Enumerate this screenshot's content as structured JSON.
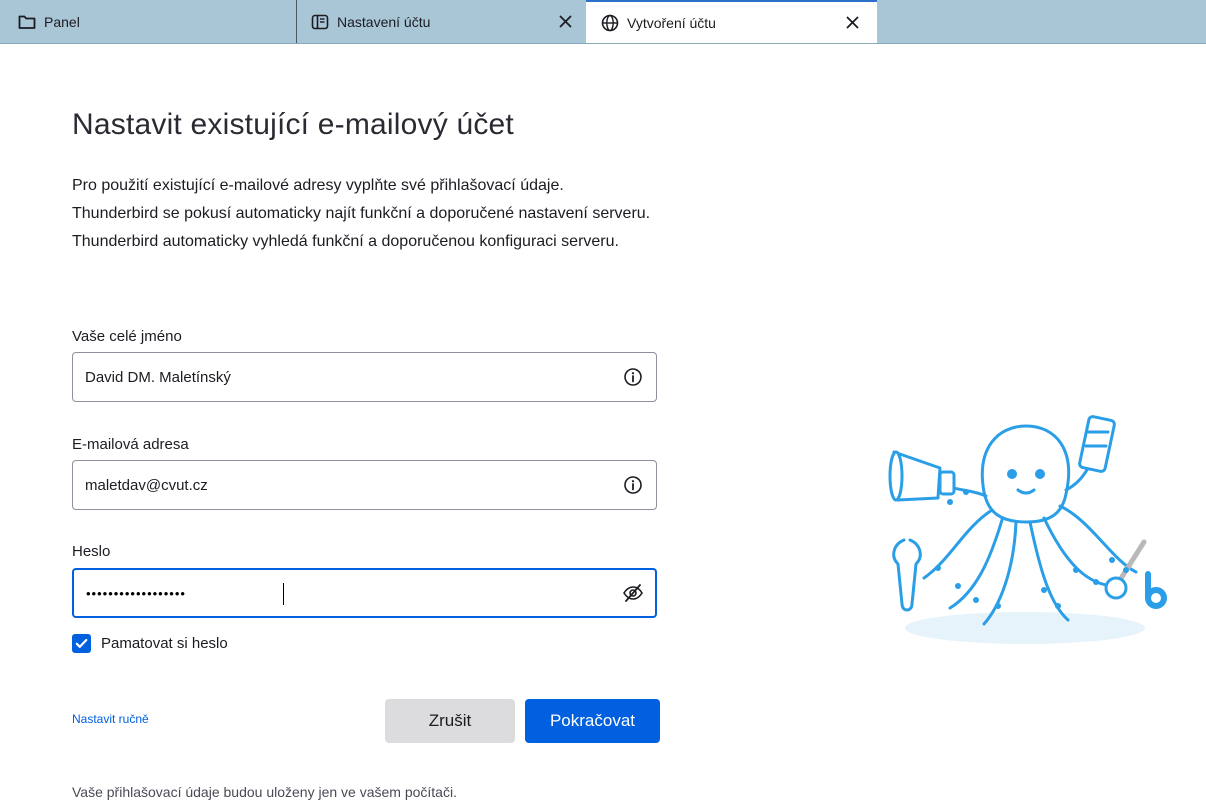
{
  "tabs": [
    {
      "label": "Panel",
      "icon": "folder-icon"
    },
    {
      "label": "Nastavení účtu",
      "icon": "account-settings-icon"
    },
    {
      "label": "Vytvoření účtu",
      "icon": "globe-icon"
    }
  ],
  "page": {
    "title": "Nastavit existující e-mailový účet",
    "description_lines": [
      "Pro použití existující e-mailové adresy vyplňte své přihlašovací údaje.",
      "Thunderbird se pokusí automaticky najít funkční a doporučené nastavení serveru.",
      "Thunderbird automaticky vyhledá funkční a doporučenou konfiguraci serveru."
    ]
  },
  "form": {
    "name_label": "Vaše celé jméno",
    "name_value": "David DM. Maletínský",
    "email_label": "E-mailová adresa",
    "email_value": "maletdav@cvut.cz",
    "password_label": "Heslo",
    "password_masked": "••••••••••••••••••",
    "remember_label": "Pamatovat si heslo",
    "remember_checked": true
  },
  "actions": {
    "manual_label": "Nastavit ručně",
    "cancel_label": "Zrušit",
    "continue_label": "Pokračovat"
  },
  "footer_note": "Vaše přihlašovací údaje budou uloženy jen ve vašem počítači.",
  "colors": {
    "tabbar": "#a9c6d6",
    "accent": "#0060df",
    "mascot": "#2a9ee6"
  }
}
